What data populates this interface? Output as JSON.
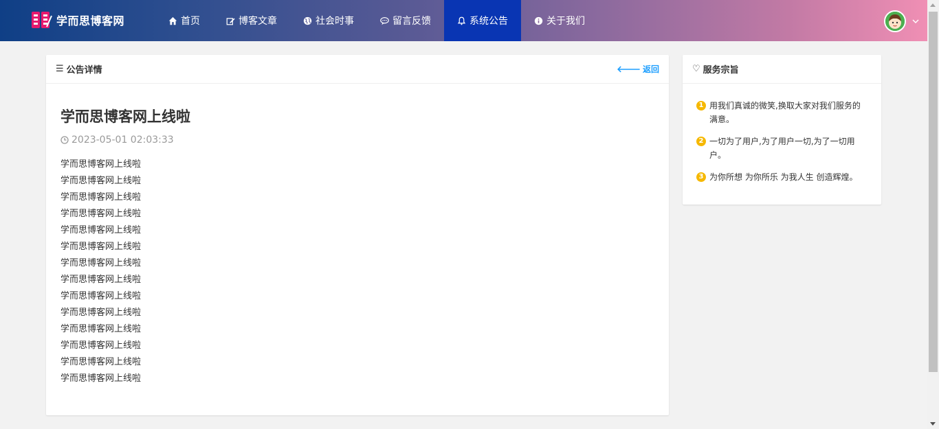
{
  "brand": {
    "name": "学而思博客网"
  },
  "nav": {
    "items": [
      {
        "label": "首页",
        "icon": "home-icon"
      },
      {
        "label": "博客文章",
        "icon": "edit-icon"
      },
      {
        "label": "社会时事",
        "icon": "globe-icon"
      },
      {
        "label": "留言反馈",
        "icon": "comment-icon"
      },
      {
        "label": "系统公告",
        "icon": "bell-icon",
        "active": true
      },
      {
        "label": "关于我们",
        "icon": "info-icon"
      }
    ]
  },
  "announcement": {
    "header": "公告详情",
    "back_label": "返回",
    "title": "学而思博客网上线啦",
    "date": "2023-05-01 02:03:33",
    "lines": [
      "学而思博客网上线啦",
      "学而思博客网上线啦",
      "学而思博客网上线啦",
      "学而思博客网上线啦",
      "学而思博客网上线啦",
      "学而思博客网上线啦",
      "学而思博客网上线啦",
      "学而思博客网上线啦",
      "学而思博客网上线啦",
      "学而思博客网上线啦",
      "学而思博客网上线啦",
      "学而思博客网上线啦",
      "学而思博客网上线啦",
      "学而思博客网上线啦"
    ]
  },
  "service": {
    "header": "服务宗旨",
    "items": [
      {
        "num": "1",
        "text": "用我们真诚的微笑,换取大家对我们服务的满意。"
      },
      {
        "num": "2",
        "text": "一切为了用户,为了用户一切,为了一切用户。"
      },
      {
        "num": "3",
        "text": "为你所想 为你所乐 为我人生 创造辉煌。"
      }
    ]
  },
  "colors": {
    "active_nav": "#0935b3",
    "link": "#1e9fff",
    "badge": "#f6b800"
  }
}
